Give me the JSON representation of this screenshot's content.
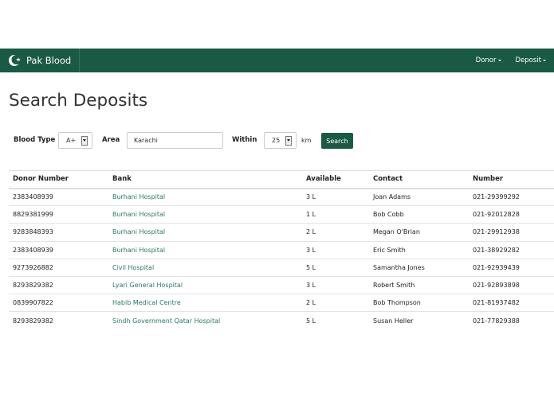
{
  "navbar": {
    "brand": "Pak Blood",
    "items": [
      {
        "label": "Donor"
      },
      {
        "label": "Deposit"
      }
    ]
  },
  "page_title": "Search Deposits",
  "search": {
    "blood_type_label": "Blood Type",
    "blood_type_value": "A+",
    "area_label": "Area",
    "area_value": "Karachi",
    "within_label": "Within",
    "within_value": "25",
    "unit": "km",
    "button_label": "Search"
  },
  "table": {
    "headers": [
      "Donor Number",
      "Bank",
      "Available",
      "Contact",
      "Number"
    ],
    "rows": [
      [
        "2383408939",
        "Burhani Hospital",
        "3 L",
        "Joan Adams",
        "021-29399292"
      ],
      [
        "8829381999",
        "Burhani Hospital",
        "1 L",
        "Bob Cobb",
        "021-92012828"
      ],
      [
        "9283848393",
        "Burhani Hospital",
        "2 L",
        "Megan O'Brian",
        "021-29912938"
      ],
      [
        "2383408939",
        "Burhani Hospital",
        "3 L",
        "Eric Smith",
        "021-38929282"
      ],
      [
        "9273926882",
        "Civil Hospital",
        "5 L",
        "Samantha Jones",
        "021-92939439"
      ],
      [
        "8293829382",
        "Lyari General Hospital",
        "3 L",
        "Robert Smith",
        "021-92893898"
      ],
      [
        "0839907822",
        "Habib Medical Centre",
        "2 L",
        "Bob Thompson",
        "021-81937482"
      ],
      [
        "8293829382",
        "Sindh Government Qatar Hospital",
        "5 L",
        "Susan Heller",
        "021-77829388"
      ]
    ]
  }
}
